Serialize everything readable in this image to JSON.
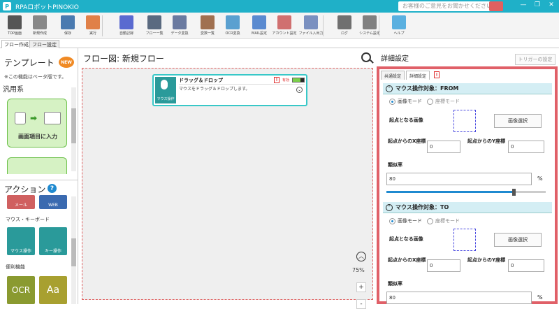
{
  "window": {
    "title": "RPAロボットPINOKIO",
    "feedback": "お客様のご意見をお聞かせください",
    "minimize": "—",
    "restore": "❐",
    "close": "✕"
  },
  "toolbar": {
    "items": [
      {
        "label": "TOP画面",
        "icon": "home-icon",
        "color": "#555555"
      },
      {
        "label": "新規作成",
        "icon": "new-file-icon",
        "color": "#888888"
      },
      {
        "label": "保存",
        "icon": "save-icon",
        "color": "#4a7ab0"
      },
      {
        "label": "実行",
        "icon": "run-icon",
        "color": "#e08048"
      },
      {
        "label": "自動記録",
        "icon": "record-icon",
        "color": "#5a6ad0"
      },
      {
        "label": "フロー一覧",
        "icon": "flow-list-icon",
        "color": "#5a6a80"
      },
      {
        "label": "データ変換",
        "icon": "data-convert-icon",
        "color": "#6a7aa0"
      },
      {
        "label": "変数一覧",
        "icon": "variable-list-icon",
        "color": "#a07050"
      },
      {
        "label": "OCR変換",
        "icon": "ocr-icon",
        "color": "#5aa0d0"
      },
      {
        "label": "MAIL設定",
        "icon": "mail-icon",
        "color": "#5a8ad0"
      },
      {
        "label": "アカウント設定",
        "icon": "account-icon",
        "color": "#d07070"
      },
      {
        "label": "ファイル入出力",
        "icon": "file-io-icon",
        "color": "#7a90c0"
      },
      {
        "label": "ログ",
        "icon": "log-icon",
        "color": "#707070"
      },
      {
        "label": "システム設定",
        "icon": "gear-icon",
        "color": "#808080"
      },
      {
        "label": "ヘルプ",
        "icon": "help-icon",
        "color": "#5ab0e0"
      }
    ]
  },
  "tabs": {
    "flow_create": "フロー作成",
    "flow_settings": "フロー設定"
  },
  "templates": {
    "title": "テンプレート",
    "badge": "NEW",
    "beta_note": "※この機能はベータ版です。",
    "category": "汎用系",
    "card_label": "画面項目に入力",
    "card_icon_left": "マウス操作",
    "card_icon_right": "キー操作"
  },
  "actions": {
    "title": "アクション",
    "help": "?",
    "tiles_top": [
      {
        "label": "メール",
        "color": "#d06060"
      },
      {
        "label": "WEB",
        "color": "#3a6ab0"
      }
    ],
    "section_mouse": "マウス・キーボード",
    "tiles_mouse": [
      {
        "label": "マウス操作",
        "color": "#2a9a9a"
      },
      {
        "label": "キー操作",
        "color": "#2a9a9a"
      }
    ],
    "section_util": "便利機能",
    "tiles_util": [
      {
        "label": "OCR",
        "color": "#8a9a30"
      },
      {
        "label": "Aa",
        "color": "#a8a030"
      }
    ]
  },
  "flow": {
    "heading": "フロー図:  新規フロー",
    "node": {
      "title": "ドラッグ＆ドロップ",
      "desc": "マウスをドラッグ＆ドロップします。",
      "icon_label": "マウス操作",
      "warn": "!",
      "enabled": "有効"
    },
    "zoom": "75%",
    "zoom_in": "+",
    "zoom_out": "-"
  },
  "details": {
    "title": "詳細設定",
    "trigger_button": "トリガーの設定",
    "tab_common": "共通設定",
    "tab_detail": "詳細設定",
    "warn": "!",
    "from": {
      "heading": "マウス操作対象：FROM",
      "mode_image": "画像モード",
      "mode_coord": "座標モード",
      "image_label": "起点となる画像",
      "select_button": "画像選択",
      "x_label": "起点からのX座標",
      "x_value": "0",
      "y_label": "起点からのY座標",
      "y_value": "0",
      "similarity_label": "類似率",
      "similarity_value": "80",
      "pct": "%"
    },
    "to": {
      "heading": "マウス操作対象：TO",
      "mode_image": "画像モード",
      "mode_coord": "座標モード",
      "image_label": "起点となる画像",
      "select_button": "画像選択",
      "x_label": "起点からのX座標",
      "x_value": "0",
      "y_label": "起点からのY座標",
      "y_value": "0",
      "similarity_label": "類似率",
      "similarity_value": "80",
      "pct": "%"
    }
  }
}
